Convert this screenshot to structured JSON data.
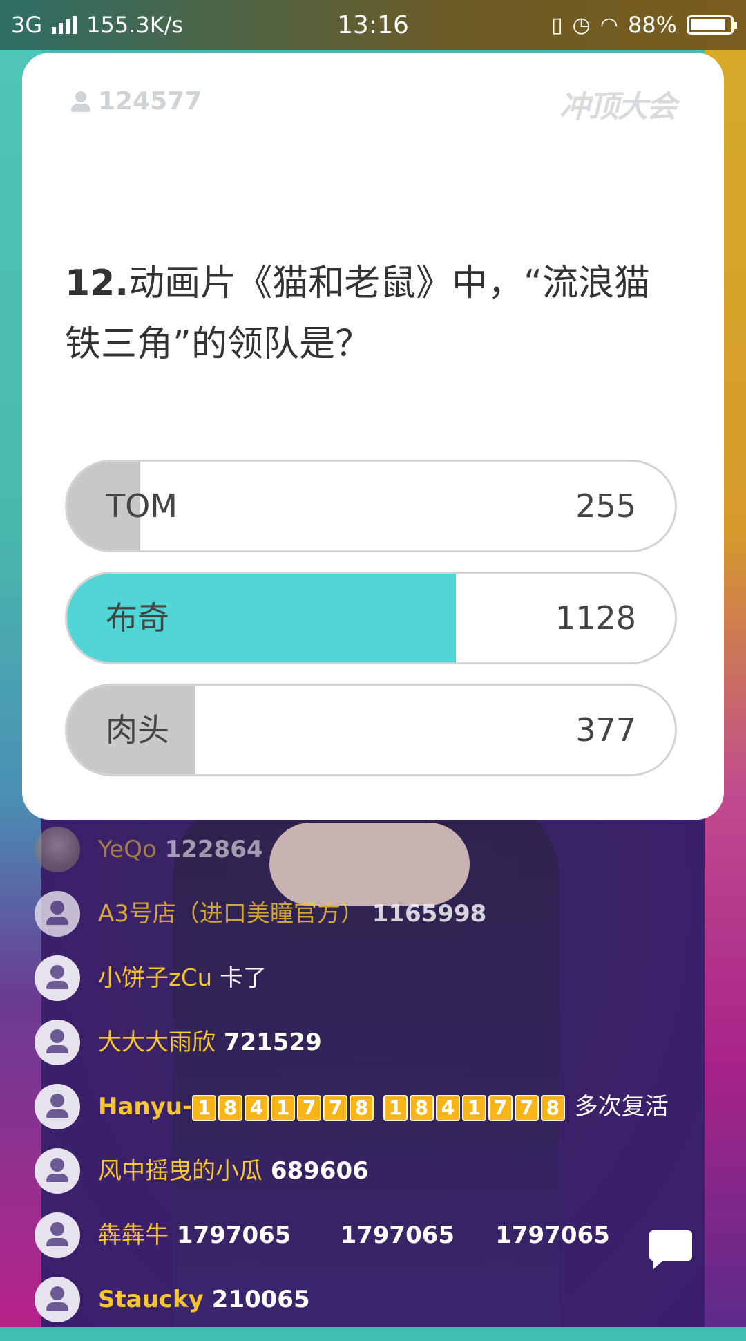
{
  "status_bar": {
    "network": "3G",
    "speed": "155.3K/s",
    "time": "13:16",
    "battery": "88%"
  },
  "card": {
    "viewer_count": "124577",
    "logo_text": "冲顶大会",
    "question_number": "12.",
    "question_text": "动画片《猫和老鼠》中，“流浪猫铁三角”的领队是？",
    "options": [
      {
        "label": "TOM",
        "count": "255",
        "fill_fraction": 0.12,
        "fill_color": "#c8c8c8"
      },
      {
        "label": "布奇",
        "count": "1128",
        "fill_fraction": 0.64,
        "fill_color": "#52d6d5"
      },
      {
        "label": "肉头",
        "count": "377",
        "fill_fraction": 0.21,
        "fill_color": "#c8c8c8"
      }
    ]
  },
  "chat": [
    {
      "name": "YeQo",
      "text": " 122864",
      "photo": true,
      "dim": 1
    },
    {
      "name": "A3号店（进口美瞳官方）",
      "text": " 1165998",
      "dim": 2
    },
    {
      "name": "小饼子zCu",
      "text": " 卡了"
    },
    {
      "name": "大大大雨欣",
      "text": " 721529"
    },
    {
      "name": "Hanyu-",
      "digits1": [
        "1",
        "8",
        "4",
        "1",
        "7",
        "7",
        "8"
      ],
      "digits2": [
        "1",
        "8",
        "4",
        "1",
        "7",
        "7",
        "8"
      ],
      "tail": " 多次复活"
    },
    {
      "name": "风中摇曳的小瓜",
      "text": " 689606"
    },
    {
      "name": "犇犇牛",
      "text": " 1797065      1797065     1797065"
    },
    {
      "name": "Staucky",
      "text": " 210065"
    }
  ]
}
